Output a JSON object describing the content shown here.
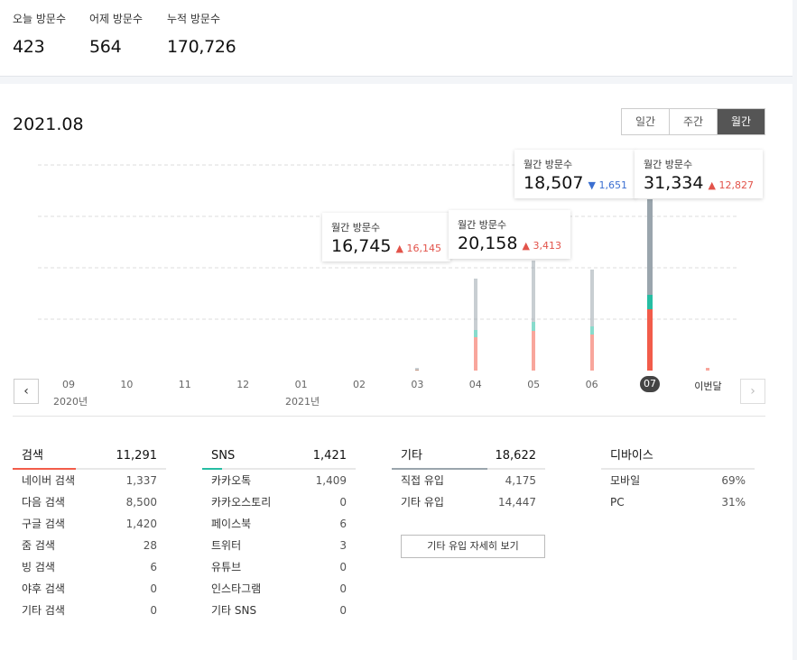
{
  "summary": {
    "today_label": "오늘 방문수",
    "today_value": "423",
    "yesterday_label": "어제 방문수",
    "yesterday_value": "564",
    "total_label": "누적 방문수",
    "total_value": "170,726"
  },
  "period": "2021.08",
  "toggle": {
    "daily": "일간",
    "weekly": "주간",
    "monthly": "월간",
    "selected": "월간"
  },
  "chart_data": {
    "type": "bar",
    "categories": [
      "09",
      "10",
      "11",
      "12",
      "01",
      "02",
      "03",
      "04",
      "05",
      "06",
      "07",
      "이번달"
    ],
    "year_labels": [
      "2020년",
      "2021년"
    ],
    "series": [
      {
        "name": "",
        "values": [
          0,
          0,
          0,
          0,
          0,
          0,
          500,
          16745,
          20158,
          18507,
          31334,
          1200
        ]
      }
    ],
    "selected_category": "07"
  },
  "tooltips": {
    "t04": {
      "title": "월간 방문수",
      "value": "16,745",
      "delta": "16,145",
      "dir": "up"
    },
    "t05": {
      "title": "월간 방문수",
      "value": "20,158",
      "delta": "3,413",
      "dir": "up"
    },
    "t06": {
      "title": "월간 방문수",
      "value": "18,507",
      "delta": "1,651",
      "dir": "down"
    },
    "t07": {
      "title": "월간 방문수",
      "value": "31,334",
      "delta": "12,827",
      "dir": "up"
    }
  },
  "colors": {
    "accent_red": "#f25c4a",
    "teal": "#26bda3",
    "gray_bar": "#9aa5ad"
  },
  "search": {
    "title": "검색",
    "total": "11,291",
    "rows": [
      {
        "label": "네이버 검색",
        "value": "1,337"
      },
      {
        "label": "다음 검색",
        "value": "8,500"
      },
      {
        "label": "구글 검색",
        "value": "1,420"
      },
      {
        "label": "줌 검색",
        "value": "28"
      },
      {
        "label": "빙 검색",
        "value": "6"
      },
      {
        "label": "야후 검색",
        "value": "0"
      },
      {
        "label": "기타 검색",
        "value": "0"
      }
    ]
  },
  "sns": {
    "title": "SNS",
    "total": "1,421",
    "rows": [
      {
        "label": "카카오톡",
        "value": "1,409"
      },
      {
        "label": "카카오스토리",
        "value": "0"
      },
      {
        "label": "페이스북",
        "value": "6"
      },
      {
        "label": "트위터",
        "value": "3"
      },
      {
        "label": "유튜브",
        "value": "0"
      },
      {
        "label": "인스타그램",
        "value": "0"
      },
      {
        "label": "기타 SNS",
        "value": "0"
      }
    ]
  },
  "etc": {
    "title": "기타",
    "total": "18,622",
    "rows": [
      {
        "label": "직접 유입",
        "value": "4,175"
      },
      {
        "label": "기타 유입",
        "value": "14,447"
      }
    ],
    "detail_button": "기타 유입 자세히 보기"
  },
  "device": {
    "title": "디바이스",
    "rows": [
      {
        "label": "모바일",
        "value": "69%"
      },
      {
        "label": "PC",
        "value": "31%"
      }
    ]
  }
}
